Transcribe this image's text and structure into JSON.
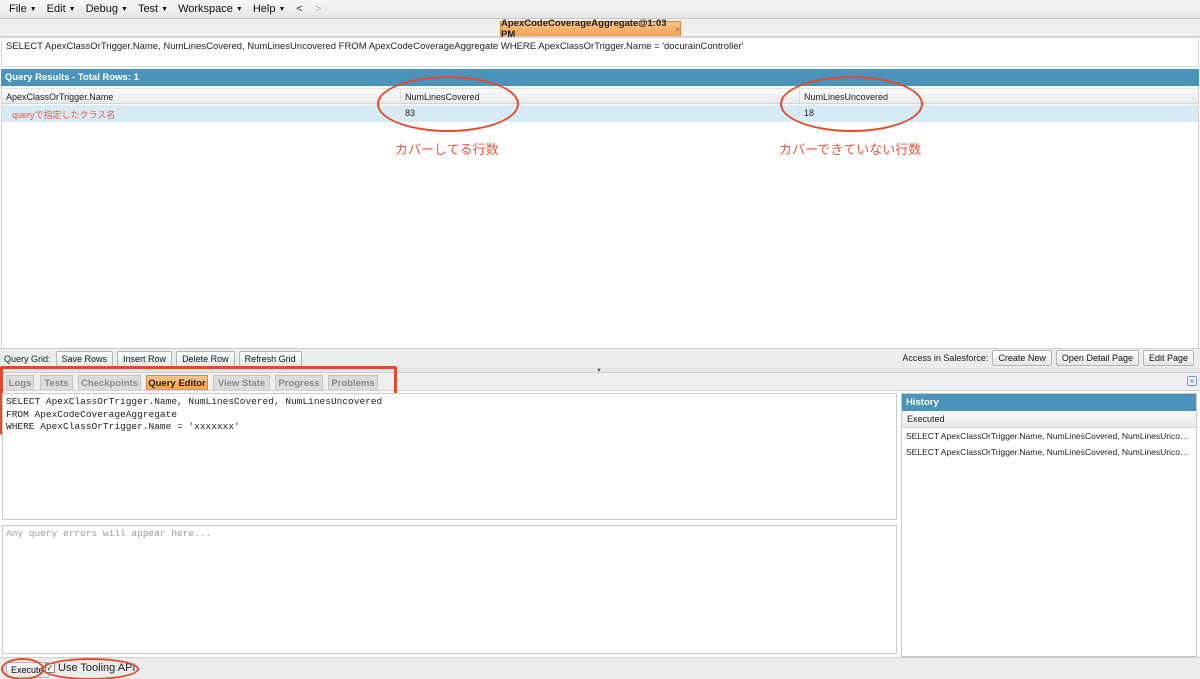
{
  "menu": {
    "items": [
      "File",
      "Edit",
      "Debug",
      "Test",
      "Workspace",
      "Help"
    ],
    "back": "<",
    "forward": ">"
  },
  "tab": {
    "title": "ApexCodeCoverageAggregate@1:03 PM",
    "close": "×"
  },
  "query_text": "SELECT ApexClassOrTrigger.Name, NumLinesCovered, NumLinesUncovered FROM ApexCodeCoverageAggregate WHERE ApexClassOrTrigger.Name = 'docurainController'",
  "results": {
    "header": "Query Results - Total Rows: 1",
    "columns": [
      "ApexClassOrTrigger.Name",
      "NumLinesCovered",
      "NumLinesUncovered"
    ],
    "rows": [
      [
        "queryで指定したクラス名",
        "83",
        "18"
      ]
    ]
  },
  "annotations": {
    "covered": "カバーしてる行数",
    "uncovered": "カバーできていない行数"
  },
  "grid_toolbar": {
    "label": "Query Grid:",
    "save_rows": "Save Rows",
    "insert_row": "Insert Row",
    "delete_row": "Delete Row",
    "refresh_grid": "Refresh Grid",
    "sf_label": "Access in Salesforce:",
    "create_new": "Create New",
    "open_detail": "Open Detail Page",
    "edit_page": "Edit Page"
  },
  "bottom_tabs": [
    "Logs",
    "Tests",
    "Checkpoints",
    "Query Editor",
    "View State",
    "Progress",
    "Problems"
  ],
  "active_bottom_tab": "Query Editor",
  "editor": {
    "text": "SELECT ApexClassOrTrigger.Name, NumLinesCovered, NumLinesUncovered\nFROM ApexCodeCoverageAggregate\nWHERE ApexClassOrTrigger.Name = 'xxxxxxx'"
  },
  "errors_placeholder": "Any query errors will appear here...",
  "history": {
    "title": "History",
    "column": "Executed",
    "rows": [
      "SELECT ApexClassOrTrigger.Name, NumLinesCovered, NumLinesUncovered F...",
      "SELECT ApexClassOrTrigger.Name, NumLinesCovered, NumLinesUncovered F..."
    ]
  },
  "bottom_bar": {
    "execute": "Execute",
    "tooling": "Use Tooling API",
    "tooling_checked": true
  },
  "colors": {
    "accent_blue": "#4a93ba",
    "active_tab_orange": "#f2a14c",
    "annotation_red": "#e8553f",
    "selected_row": "#d7ebf5"
  }
}
